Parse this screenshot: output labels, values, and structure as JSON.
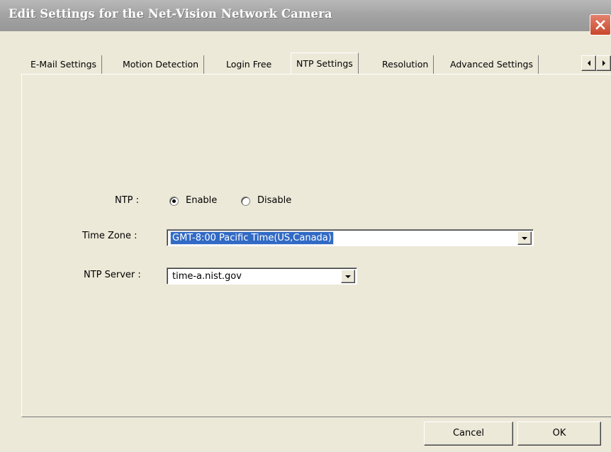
{
  "window": {
    "title": "Edit Settings for the Net-Vision Network Camera"
  },
  "tabs": [
    {
      "label": "E-Mail Settings",
      "active": false
    },
    {
      "label": "Motion Detection",
      "active": false
    },
    {
      "label": "Login Free",
      "active": false
    },
    {
      "label": "NTP Settings",
      "active": true
    },
    {
      "label": "Resolution",
      "active": false
    },
    {
      "label": "Advanced Settings",
      "active": false
    }
  ],
  "ntp": {
    "label": "NTP :",
    "options": [
      {
        "label": "Enable",
        "selected": true
      },
      {
        "label": "Disable",
        "selected": false
      }
    ]
  },
  "time_zone": {
    "label": "Time Zone :",
    "value": "GMT-8:00 Pacific Time(US,Canada)"
  },
  "ntp_server": {
    "label": "NTP Server :",
    "value": "time-a.nist.gov"
  },
  "buttons": {
    "cancel": "Cancel",
    "ok": "OK"
  },
  "colors": {
    "selection": "#316ac5",
    "close_button": "#c8482c",
    "face": "#ece9d8"
  },
  "icons": {
    "close": "close-icon",
    "tab_left": "arrow-left-icon",
    "tab_right": "arrow-right-icon",
    "dropdown": "chevron-down-icon"
  }
}
